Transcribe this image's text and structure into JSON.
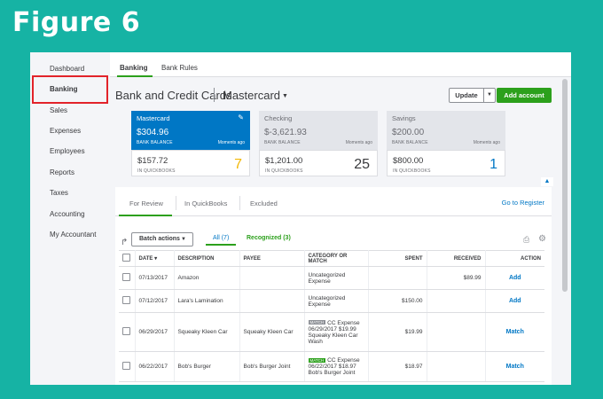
{
  "figure_title": "Figure 6",
  "sidebar": {
    "items": [
      {
        "label": "Dashboard"
      },
      {
        "label": "Banking"
      },
      {
        "label": "Sales"
      },
      {
        "label": "Expenses"
      },
      {
        "label": "Employees"
      },
      {
        "label": "Reports"
      },
      {
        "label": "Taxes"
      },
      {
        "label": "Accounting"
      },
      {
        "label": "My Accountant"
      }
    ],
    "highlight_color": "#e2232a"
  },
  "tabs": [
    {
      "label": "Banking",
      "active": true
    },
    {
      "label": "Bank Rules",
      "active": false
    }
  ],
  "header": {
    "title": "Bank and Credit Cards",
    "account": "Mastercard",
    "update_label": "Update",
    "add_account_label": "Add account"
  },
  "cards": [
    {
      "name": "Mastercard",
      "bank_balance": "$304.96",
      "bank_label": "BANK BALANCE",
      "moments": "Moments ago",
      "qb_amount": "$157.72",
      "qb_label": "IN QUICKBOOKS",
      "count": "7",
      "count_color": "#f2b705"
    },
    {
      "name": "Checking",
      "bank_balance": "$-3,621.93",
      "bank_label": "BANK BALANCE",
      "moments": "Moments ago",
      "qb_amount": "$1,201.00",
      "qb_label": "IN QUICKBOOKS",
      "count": "25",
      "count_color": "#393a3d"
    },
    {
      "name": "Savings",
      "bank_balance": "$200.00",
      "bank_label": "BANK BALANCE",
      "moments": "Moments ago",
      "qb_amount": "$800.00",
      "qb_label": "IN QUICKBOOKS",
      "count": "1",
      "count_color": "#0077c5"
    }
  ],
  "review_tabs": {
    "for_review": "For Review",
    "in_quickbooks": "In QuickBooks",
    "excluded": "Excluded",
    "go_to_register": "Go to Register"
  },
  "toolbar": {
    "batch_actions": "Batch actions",
    "filter_all": "All (7)",
    "filter_recognized": "Recognized (3)"
  },
  "table": {
    "headers": {
      "date": "DATE",
      "description": "DESCRIPTION",
      "payee": "PAYEE",
      "category": "CATEGORY OR MATCH",
      "spent": "SPENT",
      "received": "RECEIVED",
      "action": "ACTION"
    },
    "rows": [
      {
        "date": "07/13/2017",
        "description": "Amazon",
        "payee": "",
        "category_badge": "",
        "category": "Uncategorized Expense",
        "spent": "",
        "received": "$89.99",
        "action": "Add"
      },
      {
        "date": "07/12/2017",
        "description": "Lara's Lamination",
        "payee": "",
        "category_badge": "",
        "category": "Uncategorized Expense",
        "spent": "$150.00",
        "received": "",
        "action": "Add"
      },
      {
        "date": "06/29/2017",
        "description": "Squeaky Kleen Car",
        "payee": "Squeaky Kleen Car",
        "category_badge": "MATCH",
        "category": "CC Expense 06/29/2017 $19.99 Squeaky Kleen Car Wash",
        "spent": "$19.99",
        "received": "",
        "action": "Match"
      },
      {
        "date": "06/22/2017",
        "description": "Bob's Burger",
        "payee": "Bob's Burger Joint",
        "category_badge": "MATCH",
        "category": "CC Expense 06/22/2017 $18.97 Bob's Burger Joint",
        "spent": "$18.97",
        "received": "",
        "action": "Match"
      }
    ]
  }
}
